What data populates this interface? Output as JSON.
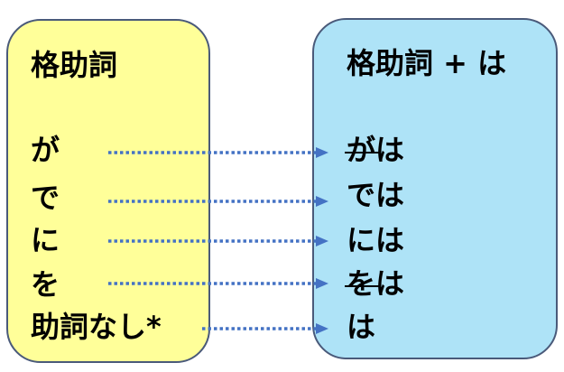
{
  "left": {
    "title": "格助詞",
    "items": [
      "が",
      "で",
      "に",
      "を",
      "助詞なし*"
    ]
  },
  "right": {
    "title": "格助詞 + は",
    "items": [
      {
        "struck": "が",
        "text": "は"
      },
      {
        "struck": "",
        "text": "では"
      },
      {
        "struck": "",
        "text": "には"
      },
      {
        "struck": "を",
        "text": "は"
      },
      {
        "struck": "",
        "text": "は"
      }
    ]
  },
  "colors": {
    "left_fill": "#ffff99",
    "right_fill": "#aee3f7",
    "border": "#4a5a7a",
    "arrow": "#4472c4"
  }
}
